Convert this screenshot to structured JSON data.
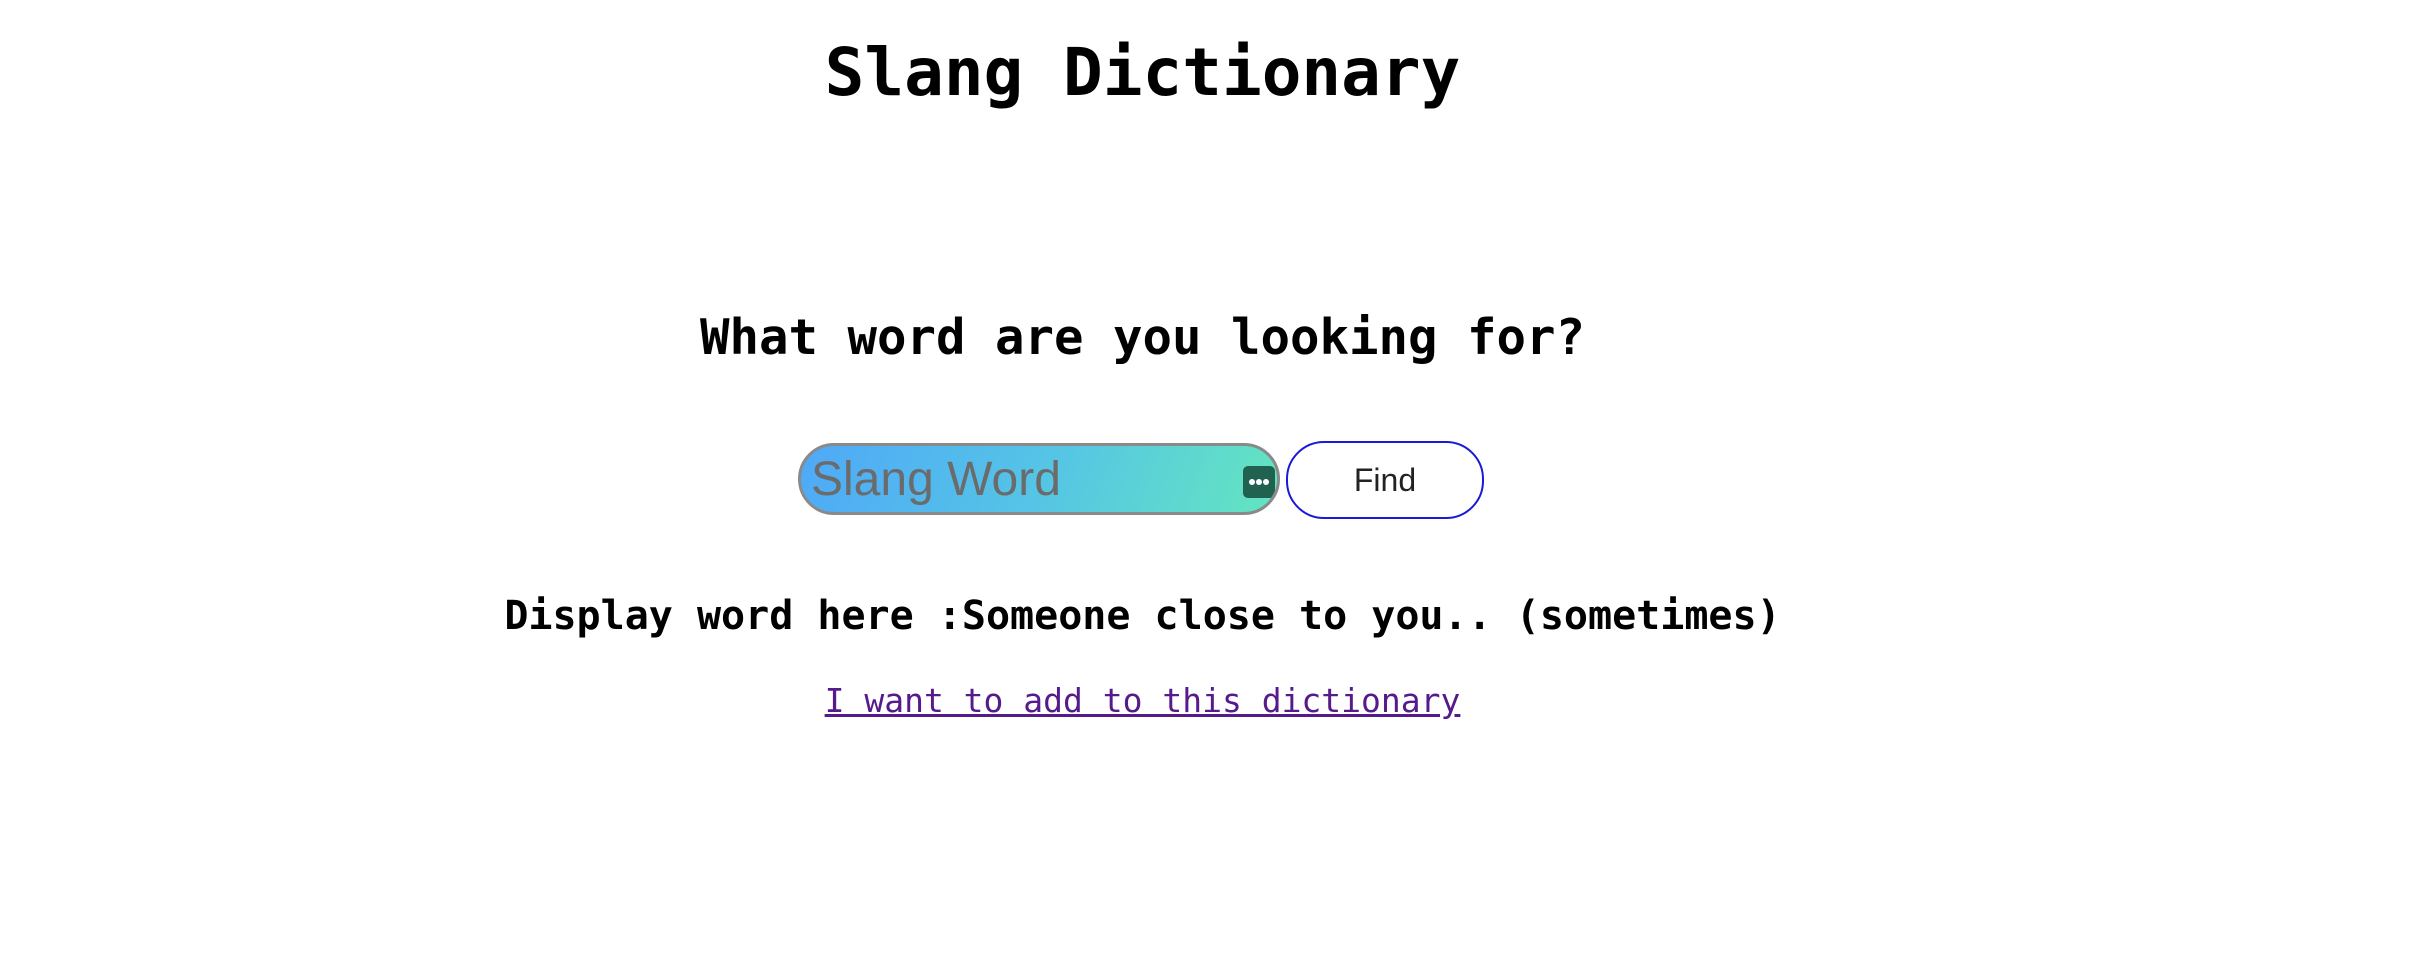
{
  "page": {
    "title": "Slang Dictionary",
    "question": "What word are you looking for?"
  },
  "search": {
    "placeholder": "Slang Word",
    "value": "",
    "autofill_icon": "more-dots-icon",
    "button_label": "Find"
  },
  "result": {
    "prefix": "Display word here :",
    "text": "Someone close to you.. (sometimes)"
  },
  "footer": {
    "add_link_label": "I want to add to this dictionary"
  },
  "colors": {
    "gradient_start": "#4fa9f7",
    "gradient_end": "#64e5c0",
    "button_border": "#1a1ad6",
    "link_visited": "#551a8b",
    "autofill_badge": "#21614f"
  }
}
